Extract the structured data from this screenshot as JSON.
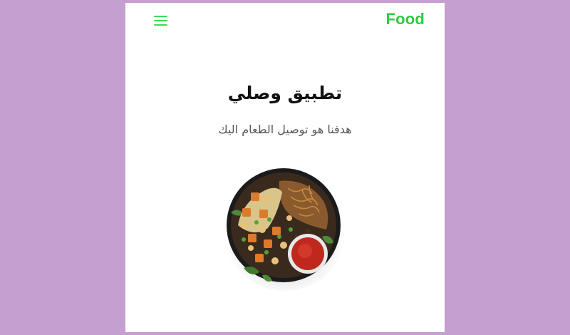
{
  "header": {
    "brand": "Food",
    "menu_icon": "hamburger-menu-icon"
  },
  "hero": {
    "title": "تطبيق وصلي",
    "subtitle": "هدفنا هو توصيل الطعام اليك",
    "image": "food-bowl-with-sauce"
  },
  "colors": {
    "background": "#c49fcf",
    "accent": "#2ecc40",
    "text": "#111111",
    "muted_text": "#555555"
  }
}
